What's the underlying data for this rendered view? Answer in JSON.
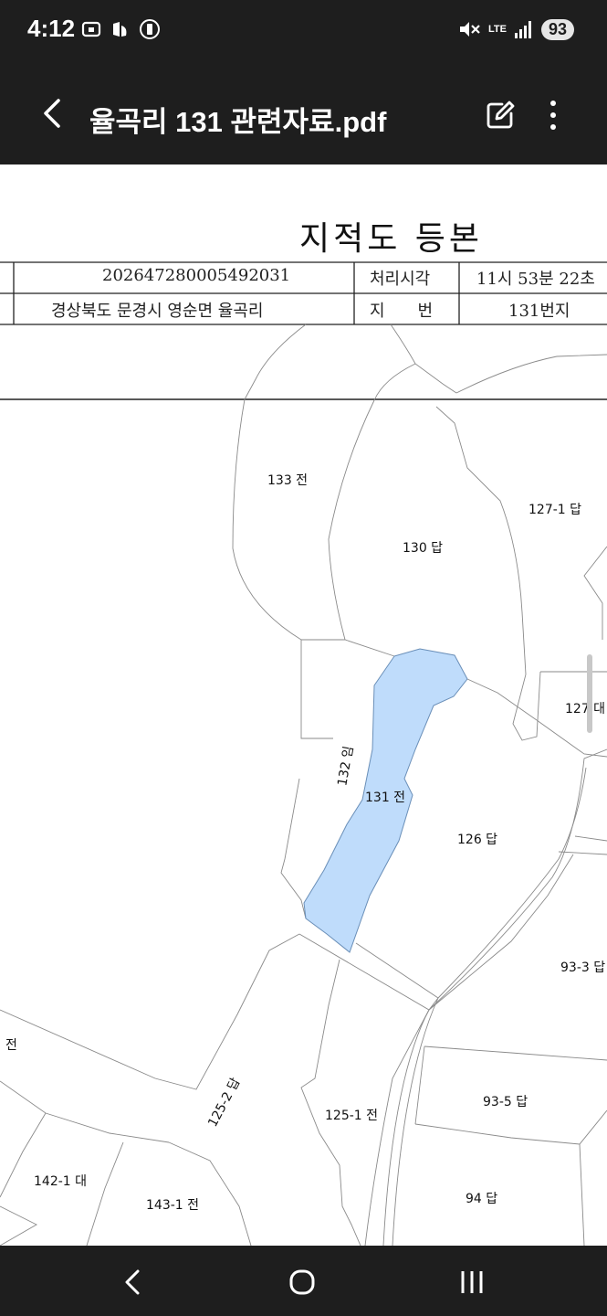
{
  "status_bar": {
    "time": "4:12",
    "battery": "93",
    "network": "LTE"
  },
  "app_bar": {
    "title": "율곡리 131 관련자료.pdf"
  },
  "document": {
    "title": "지적도 등본",
    "table": {
      "issue_number": "202647280005492031",
      "processing_time_label": "처리시각",
      "processing_time_value": "11시 53분 22초",
      "location": "경상북도 문경시 영순면 율곡리",
      "lot_label": "지　　번",
      "lot_value": "131번지"
    },
    "parcels": {
      "p133": "133 전",
      "p130": "130 답",
      "p127_1": "127-1 답",
      "p127": "127 대",
      "p132": "132 임",
      "p131": "131 전",
      "p126": "126 답",
      "p93_3": "93-3 답",
      "pjeon": "전",
      "p125_2": "125-2 답",
      "p125_1": "125-1 전",
      "p93_5": "93-5 답",
      "p142_1": "142-1 대",
      "p143_1": "143-1 전",
      "p94": "94 답"
    },
    "highlight_color": "#bfdcfb"
  }
}
